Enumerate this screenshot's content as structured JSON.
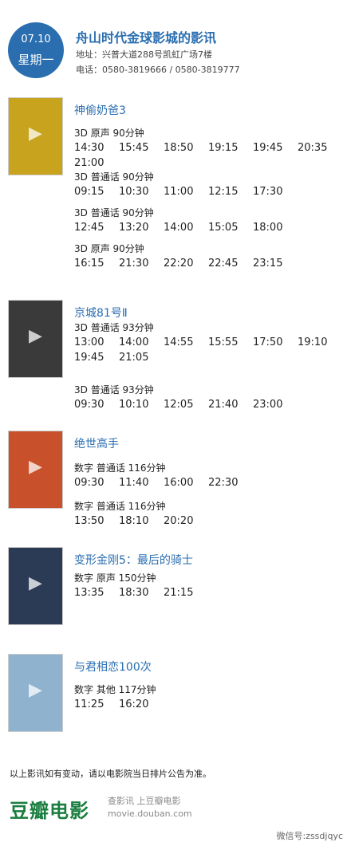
{
  "header": {
    "date": "07.10",
    "weekday": "星期一",
    "cinema_title": "舟山时代金球影城的影讯",
    "address": "地址：兴普大道288号凯虹广场7楼",
    "phone": "电话：0580-3819666 / 0580-3819777",
    "badge_color": "#2a6eb0"
  },
  "movies": [
    {
      "title": "神偷奶爸3",
      "poster_color": "#c7a31e",
      "sessions": [
        {
          "info": "3D  原声  90分钟",
          "times": [
            "14:30",
            "15:45",
            "18:50",
            "19:15",
            "19:45",
            "20:35",
            "21:00"
          ]
        },
        {
          "info": "3D  普通话  90分钟",
          "times": [
            "09:15",
            "10:30",
            "11:00",
            "12:15",
            "17:30"
          ]
        },
        {
          "info": "3D  普通话  90分钟",
          "times": [
            "12:45",
            "13:20",
            "14:00",
            "15:05",
            "18:00"
          ]
        },
        {
          "info": "3D  原声  90分钟",
          "times": [
            "16:15",
            "21:30",
            "22:20",
            "22:45",
            "23:15"
          ]
        }
      ]
    },
    {
      "title": "京城81号Ⅱ",
      "poster_color": "#3a3a3a",
      "sessions": [
        {
          "info": "3D  普通话  93分钟",
          "times": [
            "13:00",
            "14:00",
            "14:55",
            "15:55",
            "17:50",
            "19:10",
            "19:45",
            "21:05"
          ]
        },
        {
          "info": "3D  普通话  93分钟",
          "times": [
            "09:30",
            "10:10",
            "12:05",
            "21:40",
            "23:00"
          ]
        }
      ]
    },
    {
      "title": "绝世高手",
      "poster_color": "#c8502a",
      "sessions": [
        {
          "info": "数字  普通话  116分钟",
          "times": [
            "09:30",
            "11:40",
            "16:00",
            "22:30"
          ]
        },
        {
          "info": "数字  普通话  116分钟",
          "times": [
            "13:50",
            "18:10",
            "20:20"
          ]
        }
      ]
    },
    {
      "title": "变形金刚5：最后的骑士",
      "poster_color": "#2b3a55",
      "sessions": [
        {
          "info": "数字  原声  150分钟",
          "times": [
            "13:35",
            "18:30",
            "21:15"
          ]
        }
      ]
    },
    {
      "title": "与君相恋100次",
      "poster_color": "#8fb3cf",
      "sessions": [
        {
          "info": "数字  其他  117分钟",
          "times": [
            "11:25",
            "16:20"
          ]
        }
      ]
    }
  ],
  "footer": {
    "note": "以上影讯如有变动，请以电影院当日排片公告为准。",
    "logo": "豆瓣电影",
    "tagline": "查影讯  上豆瓣电影",
    "url": "movie.douban.com",
    "wechat": "微信号:zssdjqyc",
    "logo_color": "#1a7e40"
  }
}
